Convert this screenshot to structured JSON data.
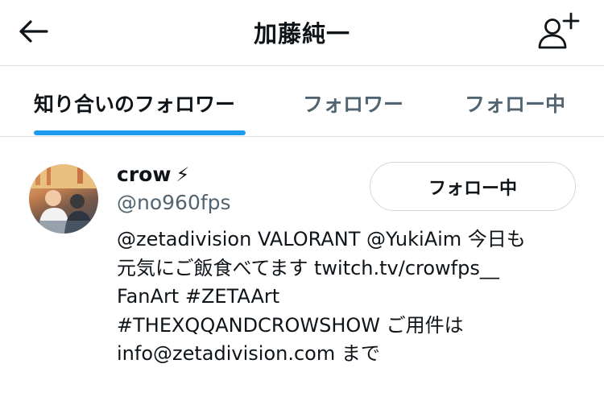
{
  "header": {
    "title": "加藤純一",
    "back_icon": "arrow-left-icon",
    "add_user_icon": "person-plus-icon"
  },
  "tabs": [
    {
      "label": "知り合いのフォロワー",
      "active": true
    },
    {
      "label": "フォロワー",
      "active": false
    },
    {
      "label": "フォロー中",
      "active": false
    }
  ],
  "accent_color": "#1d9bf0",
  "user": {
    "name": "crow",
    "name_emoji": "⚡",
    "handle": "@no960fps",
    "follow_button_label": "フォロー中",
    "bio_lines": [
      "@zetadivision VALORANT @YukiAim 今日も",
      "元気にご飯食べてます twitch.tv/crowfps__",
      "FanArt #ZETAArt",
      "#THEXQQANDCROWSHOW ご用件は",
      "info@zetadivision.com まで"
    ]
  }
}
